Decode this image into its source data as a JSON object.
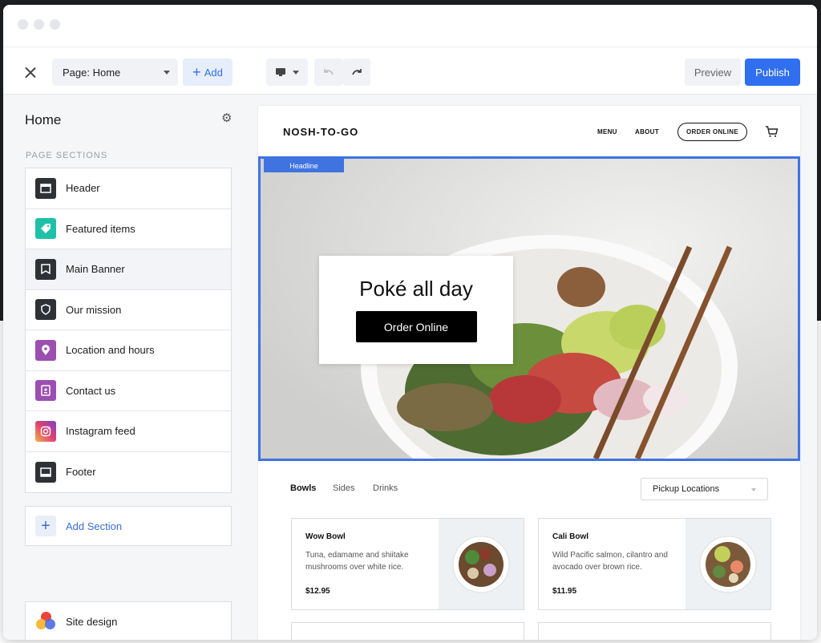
{
  "toolbar": {
    "page_select": "Page: Home",
    "add_label": "Add",
    "preview_label": "Preview",
    "publish_label": "Publish",
    "accent": "#2f6ff0"
  },
  "sidebar": {
    "title": "Home",
    "sections_label": "PAGE SECTIONS",
    "items": [
      {
        "label": "Header",
        "icon": "header-icon",
        "color": "#2e3136"
      },
      {
        "label": "Featured items",
        "icon": "tag-icon",
        "color": "#1fc0a8"
      },
      {
        "label": "Main Banner",
        "icon": "banner-icon",
        "color": "#2e3136"
      },
      {
        "label": "Our mission",
        "icon": "shield-icon",
        "color": "#2e3136"
      },
      {
        "label": "Location and hours",
        "icon": "location-pin-icon",
        "color": "#9b4fb0"
      },
      {
        "label": "Contact us",
        "icon": "contact-icon",
        "color": "#9b4fb0"
      },
      {
        "label": "Instagram feed",
        "icon": "instagram-icon",
        "color": "#d93f73"
      },
      {
        "label": "Footer",
        "icon": "footer-icon",
        "color": "#2e3136"
      }
    ],
    "add_section_label": "Add Section",
    "site_design_label": "Site design"
  },
  "preview": {
    "brand": "NOSH-TO-GO",
    "nav": {
      "menu": "MENU",
      "about": "ABOUT",
      "order_online": "ORDER ONLINE"
    },
    "headline_tag": "Headline",
    "hero_title": "Poké all day",
    "hero_button": "Order Online",
    "tabs": [
      "Bowls",
      "Sides",
      "Drinks"
    ],
    "location_select": "Pickup Locations",
    "cards": [
      {
        "name": "Wow Bowl",
        "desc": "Tuna, edamame and shiitake mushrooms over white rice.",
        "price": "$12.95"
      },
      {
        "name": "Cali Bowl",
        "desc": "Wild Pacific salmon, cilantro and avocado over brown rice.",
        "price": "$11.95"
      }
    ]
  }
}
